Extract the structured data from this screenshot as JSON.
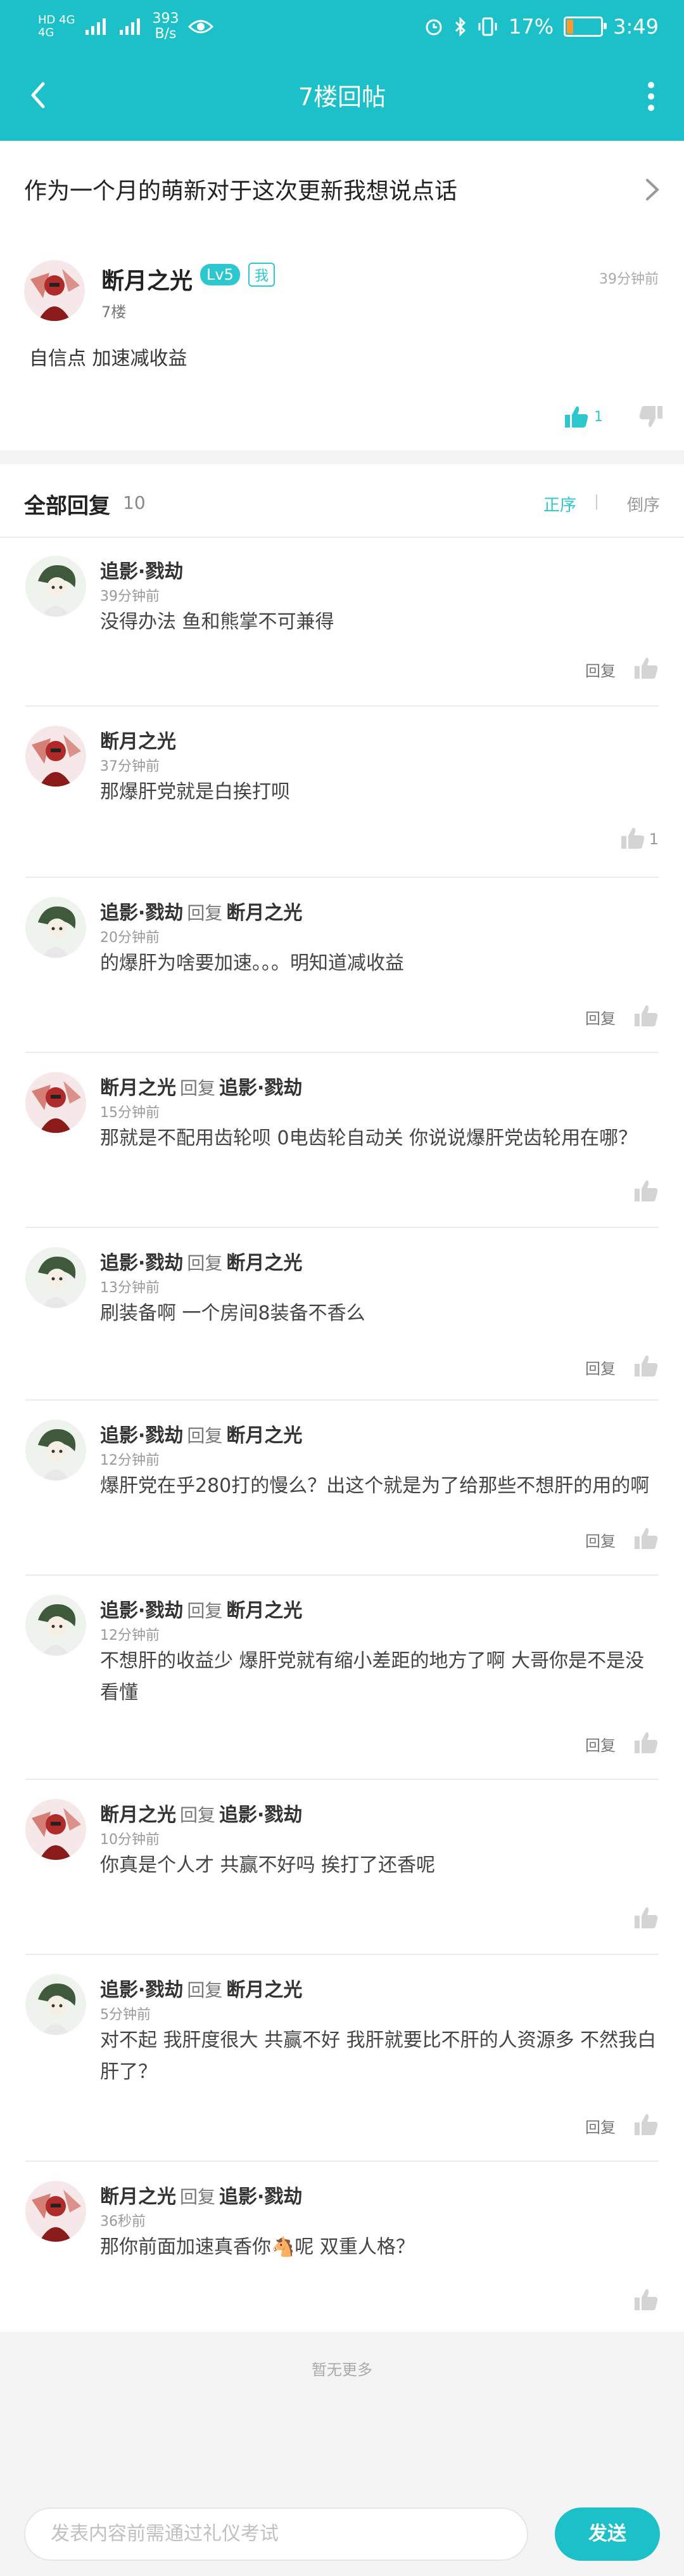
{
  "status_bar": {
    "net_left_a": "HD 4G",
    "net_left_b": "4G",
    "speed_value": "393",
    "speed_unit": "B/s",
    "battery": "17%",
    "battery_level": 0.17,
    "time": "3:49"
  },
  "nav": {
    "title": "7楼回帖"
  },
  "thread": {
    "title": "作为一个月的萌新对于这次更新我想说点话"
  },
  "op": {
    "name": "断月之光",
    "level": "Lv5",
    "me_badge": "我",
    "floor": "7楼",
    "time": "39分钟前",
    "content": "自信点  加速减收益",
    "likes": "1"
  },
  "replies_header": {
    "title": "全部回复",
    "count": "10",
    "sort_asc": "正序",
    "separator": "|",
    "sort_desc": "倒序"
  },
  "reply_verb": "回复",
  "reply_action": "回复",
  "replies": [
    {
      "author": "追影·戮劫",
      "target": "",
      "time": "39分钟前",
      "text": "没得办法  鱼和熊掌不可兼得",
      "likes": ""
    },
    {
      "author": "断月之光",
      "target": "",
      "time": "37分钟前",
      "text": "那爆肝党就是白挨打呗",
      "likes": "1"
    },
    {
      "author": "追影·戮劫",
      "target": "断月之光",
      "time": "20分钟前",
      "text": "的爆肝为啥要加速。。。明知道减收益",
      "likes": ""
    },
    {
      "author": "断月之光",
      "target": "追影·戮劫",
      "time": "15分钟前",
      "text": "那就是不配用齿轮呗  0电齿轮自动关  你说说爆肝党齿轮用在哪？",
      "likes": ""
    },
    {
      "author": "追影·戮劫",
      "target": "断月之光",
      "time": "13分钟前",
      "text": "刷装备啊   一个房间8装备不香么",
      "likes": ""
    },
    {
      "author": "追影·戮劫",
      "target": "断月之光",
      "time": "12分钟前",
      "text": "爆肝党在乎280打的慢么？出这个就是为了给那些不想肝的用的啊",
      "likes": ""
    },
    {
      "author": "追影·戮劫",
      "target": "断月之光",
      "time": "12分钟前",
      "text": "不想肝的收益少  爆肝党就有缩小差距的地方了啊  大哥你是不是没看懂",
      "likes": ""
    },
    {
      "author": "断月之光",
      "target": "追影·戮劫",
      "time": "10分钟前",
      "text": "你真是个人才  共赢不好吗  挨打了还香呢",
      "likes": ""
    },
    {
      "author": "追影·戮劫",
      "target": "断月之光",
      "time": "5分钟前",
      "text": "对不起  我肝度很大 共赢不好  我肝就要比不肝的人资源多  不然我白肝了？",
      "likes": ""
    },
    {
      "author": "断月之光",
      "target": "追影·戮劫",
      "time": "36秒前",
      "text": "那你前面加速真香你🐴呢  双重人格？",
      "likes": ""
    }
  ],
  "footer": {
    "no_more": "暂无更多",
    "input_placeholder": "发表内容前需通过礼仪考试",
    "send": "发送"
  },
  "colors": {
    "accent": "#1cc0c8",
    "text_dark": "#222222",
    "text_muted": "#999999"
  }
}
